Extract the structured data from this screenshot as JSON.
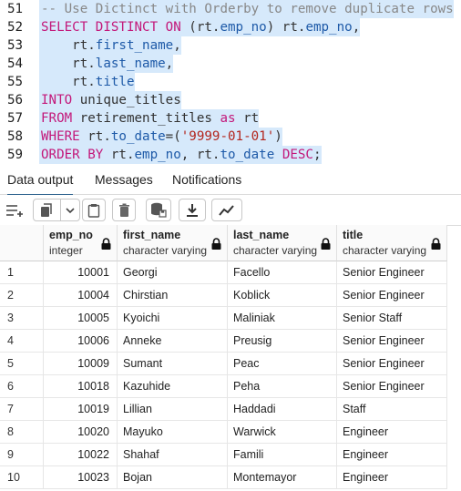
{
  "editor": {
    "lines": [
      {
        "num": "51",
        "tokens": [
          {
            "t": "-- Use Dictinct with Orderby to remove duplicate rows",
            "c": "cm"
          }
        ]
      },
      {
        "num": "52",
        "tokens": [
          {
            "t": "SELECT DISTINCT ON ",
            "c": "kw"
          },
          {
            "t": "(rt.",
            "c": "op"
          },
          {
            "t": "emp_no",
            "c": "pr"
          },
          {
            "t": ") rt.",
            "c": "op"
          },
          {
            "t": "emp_no",
            "c": "pr"
          },
          {
            "t": ",",
            "c": "op"
          }
        ]
      },
      {
        "num": "53",
        "tokens": [
          {
            "t": "    rt.",
            "c": "op"
          },
          {
            "t": "first_name",
            "c": "pr"
          },
          {
            "t": ",",
            "c": "op"
          }
        ]
      },
      {
        "num": "54",
        "tokens": [
          {
            "t": "    rt.",
            "c": "op"
          },
          {
            "t": "last_name",
            "c": "pr"
          },
          {
            "t": ",",
            "c": "op"
          }
        ]
      },
      {
        "num": "55",
        "tokens": [
          {
            "t": "    rt.",
            "c": "op"
          },
          {
            "t": "title",
            "c": "pr"
          }
        ]
      },
      {
        "num": "56",
        "tokens": [
          {
            "t": "INTO ",
            "c": "kw"
          },
          {
            "t": "unique_titles",
            "c": "id"
          }
        ]
      },
      {
        "num": "57",
        "tokens": [
          {
            "t": "FROM ",
            "c": "kw"
          },
          {
            "t": "retirement_titles ",
            "c": "id"
          },
          {
            "t": "as ",
            "c": "kw"
          },
          {
            "t": "rt",
            "c": "id"
          }
        ]
      },
      {
        "num": "58",
        "tokens": [
          {
            "t": "WHERE ",
            "c": "kw"
          },
          {
            "t": "rt.",
            "c": "op"
          },
          {
            "t": "to_date",
            "c": "pr"
          },
          {
            "t": "=(",
            "c": "op"
          },
          {
            "t": "'9999-01-01'",
            "c": "st"
          },
          {
            "t": ")",
            "c": "op"
          }
        ]
      },
      {
        "num": "59",
        "tokens": [
          {
            "t": "ORDER BY ",
            "c": "kw"
          },
          {
            "t": "rt.",
            "c": "op"
          },
          {
            "t": "emp_no",
            "c": "pr"
          },
          {
            "t": ", rt.",
            "c": "op"
          },
          {
            "t": "to_date ",
            "c": "pr"
          },
          {
            "t": "DESC",
            "c": "kw"
          },
          {
            "t": ";",
            "c": "op"
          }
        ]
      }
    ]
  },
  "tabs": [
    {
      "label": "Data output",
      "active": true
    },
    {
      "label": "Messages",
      "active": false
    },
    {
      "label": "Notifications",
      "active": false
    }
  ],
  "toolbar": {
    "icons": [
      "add-row-icon",
      "copy-icon",
      "dropdown-chevron-icon",
      "paste-icon",
      "delete-icon",
      "save-data-icon",
      "download-icon",
      "graph-icon"
    ]
  },
  "grid": {
    "columns": [
      {
        "name": "emp_no",
        "type": "integer"
      },
      {
        "name": "first_name",
        "type": "character varying"
      },
      {
        "name": "last_name",
        "type": "character varying"
      },
      {
        "name": "title",
        "type": "character varying"
      }
    ],
    "rows": [
      [
        "1",
        "10001",
        "Georgi",
        "Facello",
        "Senior Engineer"
      ],
      [
        "2",
        "10004",
        "Chirstian",
        "Koblick",
        "Senior Engineer"
      ],
      [
        "3",
        "10005",
        "Kyoichi",
        "Maliniak",
        "Senior Staff"
      ],
      [
        "4",
        "10006",
        "Anneke",
        "Preusig",
        "Senior Engineer"
      ],
      [
        "5",
        "10009",
        "Sumant",
        "Peac",
        "Senior Engineer"
      ],
      [
        "6",
        "10018",
        "Kazuhide",
        "Peha",
        "Senior Engineer"
      ],
      [
        "7",
        "10019",
        "Lillian",
        "Haddadi",
        "Staff"
      ],
      [
        "8",
        "10020",
        "Mayuko",
        "Warwick",
        "Engineer"
      ],
      [
        "9",
        "10022",
        "Shahaf",
        "Famili",
        "Engineer"
      ],
      [
        "10",
        "10023",
        "Bojan",
        "Montemayor",
        "Engineer"
      ]
    ]
  }
}
